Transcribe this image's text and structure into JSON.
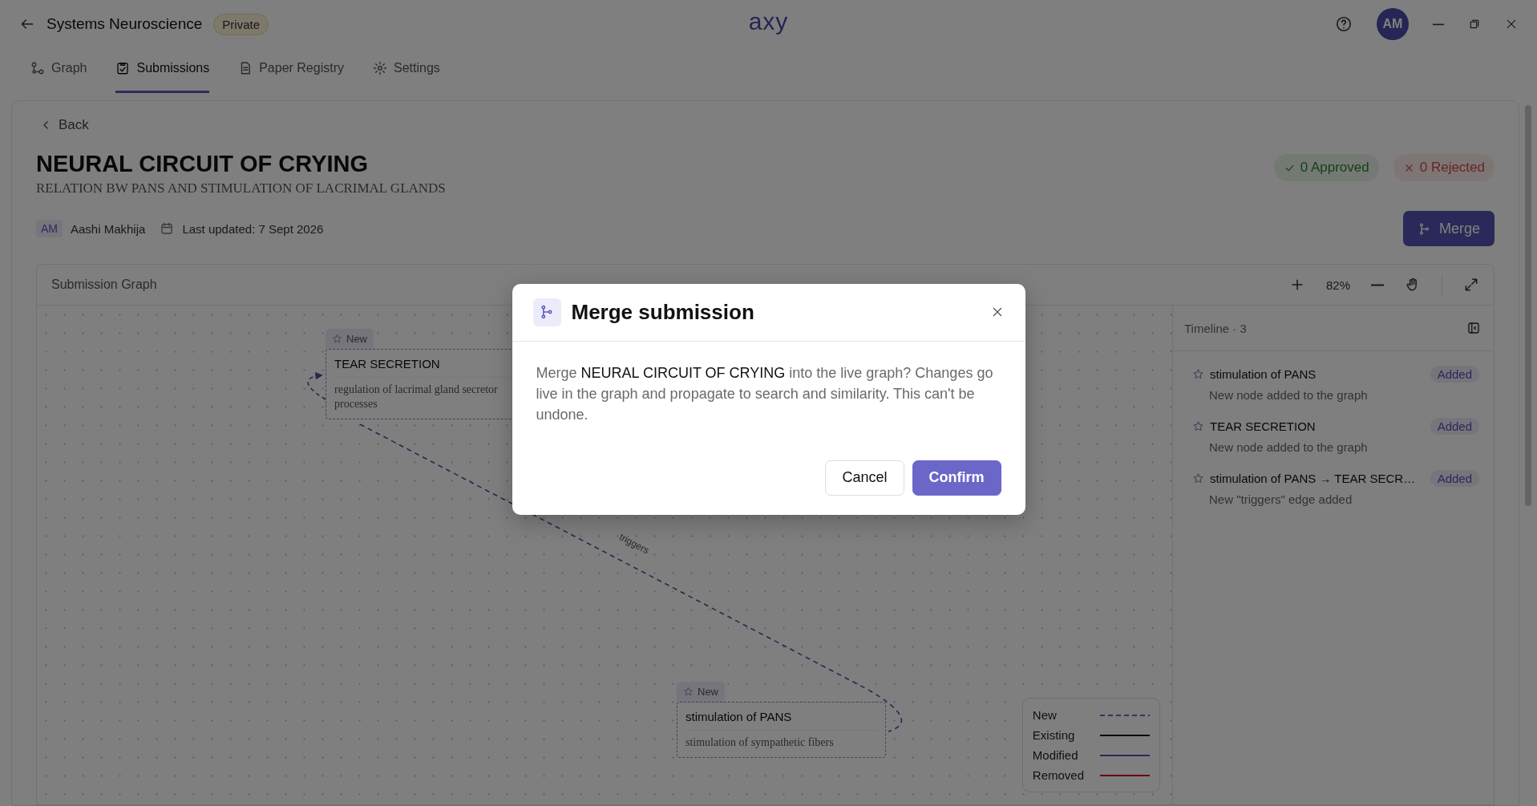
{
  "app": {
    "workspace": "Systems Neuroscience",
    "visibility": "Private",
    "logo": "axy",
    "avatar": "AM"
  },
  "tabs": [
    {
      "label": "Graph",
      "selected": false
    },
    {
      "label": "Submissions",
      "selected": true
    },
    {
      "label": "Paper Registry",
      "selected": false
    },
    {
      "label": "Settings",
      "selected": false
    }
  ],
  "submission": {
    "back": "Back",
    "title": "NEURAL CIRCUIT OF CRYING",
    "subtitle": "RELATION BW PANS AND STIMULATION OF LACRIMAL GLANDS",
    "approved": "0 Approved",
    "rejected": "0 Rejected",
    "author_initials": "AM",
    "author": "Aashi Makhija",
    "updated": "Last updated: 7 Sept 2026",
    "merge": "Merge"
  },
  "graph": {
    "title": "Submission Graph",
    "zoom": "82%",
    "nodes": [
      {
        "tag": "New",
        "title": "TEAR SECRETION",
        "description_lines": [
          "regulation of lacrimal gland secretor",
          "processes"
        ]
      },
      {
        "tag": "New",
        "title": "stimulation of PANS",
        "description_lines": [
          "stimulation of sympathetic fibers"
        ]
      }
    ],
    "edge_label": "triggers",
    "legend": [
      {
        "label": "New",
        "kind": "new"
      },
      {
        "label": "Existing",
        "kind": "existing"
      },
      {
        "label": "Modified",
        "kind": "modified"
      },
      {
        "label": "Removed",
        "kind": "removed"
      }
    ]
  },
  "timeline": {
    "title": "Timeline · 3",
    "items": [
      {
        "title": "stimulation of PANS",
        "badge": "Added",
        "description": "New node added to the graph"
      },
      {
        "title": "TEAR SECRETION",
        "badge": "Added",
        "description": "New node added to the graph"
      },
      {
        "title": "stimulation of PANS → TEAR SECR…",
        "badge": "Added",
        "description": "New \"triggers\" edge added"
      }
    ]
  },
  "dialog": {
    "title": "Merge submission",
    "message": "Merge **NEURAL CIRCUIT OF CRYING** into the live graph? Changes go live in the graph and propagate to search and similarity. This can't be undone.",
    "buttons": [
      {
        "label": "Cancel",
        "kind": "secondary"
      },
      {
        "label": "Confirm",
        "kind": "primary"
      }
    ]
  }
}
